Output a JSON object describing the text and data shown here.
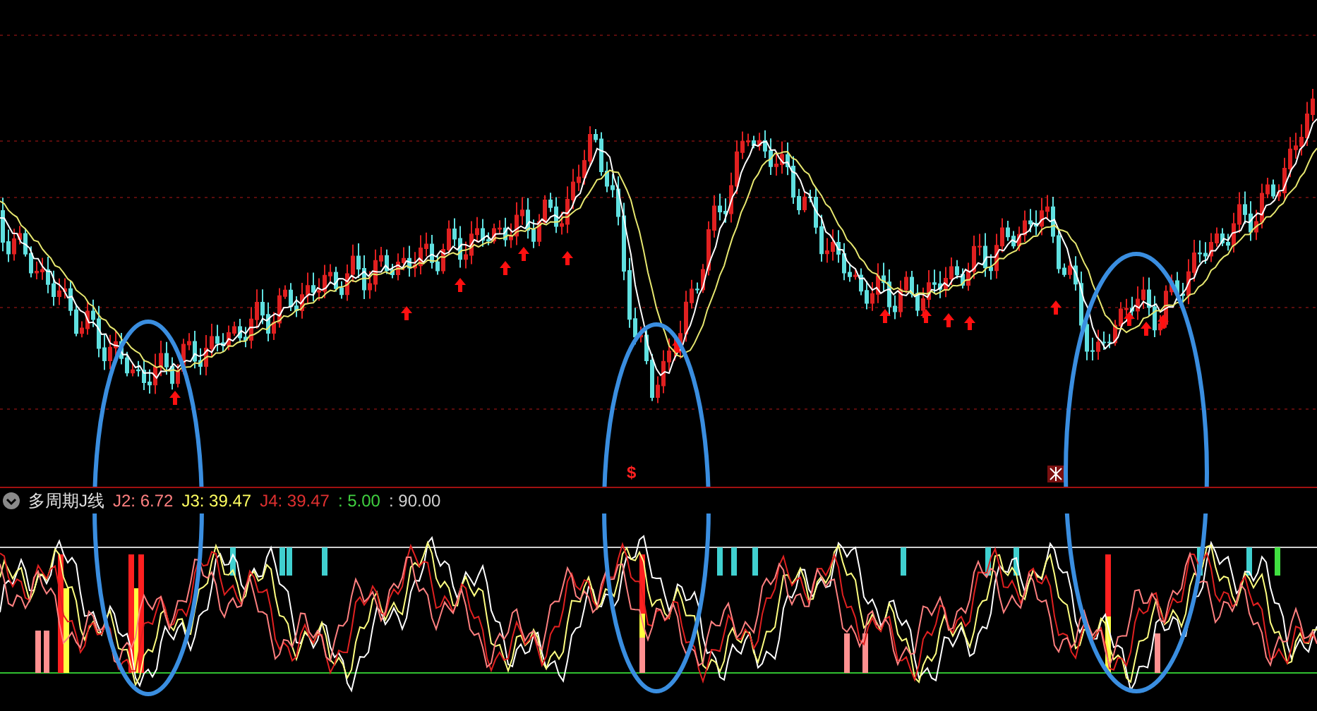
{
  "price_panel": {
    "markers": [
      {
        "text": "$"
      }
    ]
  },
  "indicator": {
    "name": "多周期J线",
    "values": [
      {
        "text": "J2: 6.72",
        "color": "#ff8080"
      },
      {
        "text": "J3: 39.47",
        "color": "#ffff60"
      },
      {
        "text": "J4: 39.47",
        "color": "#e03030"
      },
      {
        "text": ": 5.00",
        "color": "#40d040"
      },
      {
        "text": ": 90.00",
        "color": "#d0d0d0"
      }
    ]
  }
}
